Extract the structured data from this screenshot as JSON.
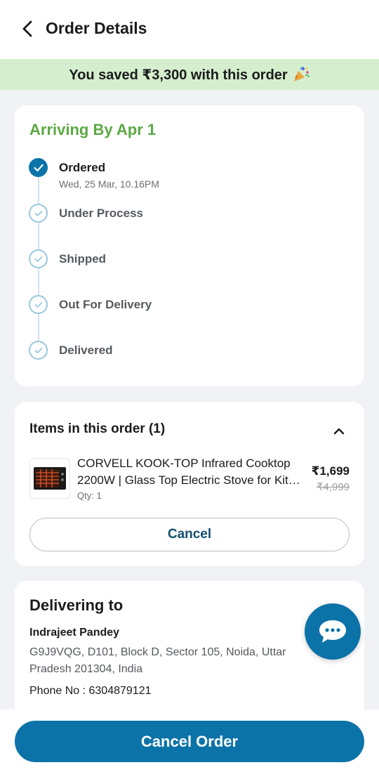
{
  "header": {
    "title": "Order Details"
  },
  "savings_banner": {
    "text": "You saved ₹3,300 with this order",
    "icon": "party-popper-icon"
  },
  "status": {
    "arriving": "Arriving By Apr 1",
    "steps": [
      {
        "label": "Ordered",
        "sub": "Wed, 25 Mar, 10.16PM",
        "done": true
      },
      {
        "label": "Under Process",
        "done": false
      },
      {
        "label": "Shipped",
        "done": false
      },
      {
        "label": "Out For Delivery",
        "done": false
      },
      {
        "label": "Delivered",
        "done": false
      }
    ]
  },
  "items": {
    "title": "Items in this order (1)",
    "product": {
      "name": "CORVELL KOOK-TOP Infrared Cooktop 2200W | Glass Top Electric Stove for Kit…",
      "price": "₹1,699",
      "mrp": "₹4,999",
      "qty": "Qty: 1"
    },
    "cancel_label": "Cancel"
  },
  "delivery": {
    "title": "Delivering to",
    "name": "Indrajeet Pandey",
    "address": "G9J9VQG, D101, Block D, Sector 105, Noida, Uttar Pradesh 201304, India",
    "phone": "Phone No : 6304879121"
  },
  "bottom": {
    "cancel_order_label": "Cancel Order"
  },
  "colors": {
    "accent": "#0c73a8",
    "success": "#5ba843",
    "banner_bg": "#d5efce"
  }
}
